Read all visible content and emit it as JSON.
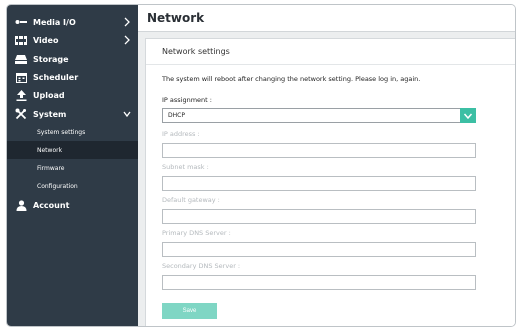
{
  "sidebar": {
    "items": [
      {
        "label": "Media I/O",
        "icon": "media-io-icon",
        "chevron": "right"
      },
      {
        "label": "Video",
        "icon": "video-icon",
        "chevron": "right"
      },
      {
        "label": "Storage",
        "icon": "storage-icon"
      },
      {
        "label": "Scheduler",
        "icon": "calendar-icon"
      },
      {
        "label": "Upload",
        "icon": "upload-icon"
      },
      {
        "label": "System",
        "icon": "tools-icon",
        "chevron": "down",
        "expanded": true
      },
      {
        "label": "Account",
        "icon": "user-icon"
      }
    ],
    "system_subitems": [
      {
        "label": "System settings"
      },
      {
        "label": "Network",
        "active": true
      },
      {
        "label": "Firmware"
      },
      {
        "label": "Configuration"
      }
    ]
  },
  "header": {
    "title": "Network"
  },
  "card": {
    "title": "Network settings",
    "notice": "The system will reboot after changing the network setting. Please log in, again.",
    "ip_assignment": {
      "label": "IP assignment :",
      "value": "DHCP"
    },
    "fields": [
      {
        "label": "IP address :",
        "value": ""
      },
      {
        "label": "Subnet mask :",
        "value": ""
      },
      {
        "label": "Default gateway :",
        "value": ""
      },
      {
        "label": "Primary DNS Server :",
        "value": ""
      },
      {
        "label": "Secondary DNS Server :",
        "value": ""
      }
    ],
    "save_label": "Save"
  },
  "colors": {
    "sidebar_bg": "#2f3b47",
    "sidebar_active_bg": "#1f2730",
    "accent": "#3cbfa4",
    "button_disabled": "#7fd6c4"
  }
}
